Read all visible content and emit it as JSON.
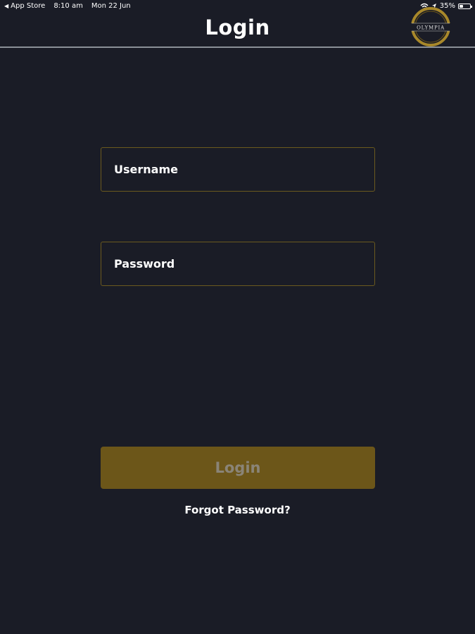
{
  "status_bar": {
    "back_label": "App Store",
    "time": "8:10 am",
    "date": "Mon 22 Jun",
    "battery": "35%",
    "battery_level": 0.35
  },
  "header": {
    "title": "Login",
    "logo_text": "OLYMPIA"
  },
  "form": {
    "username_placeholder": "Username",
    "password_placeholder": "Password",
    "login_label": "Login",
    "forgot_label": "Forgot Password?"
  },
  "colors": {
    "background": "#1a1c26",
    "accent": "#6c5619",
    "field_border": "#6b5a1e",
    "divider": "#8a9097"
  }
}
